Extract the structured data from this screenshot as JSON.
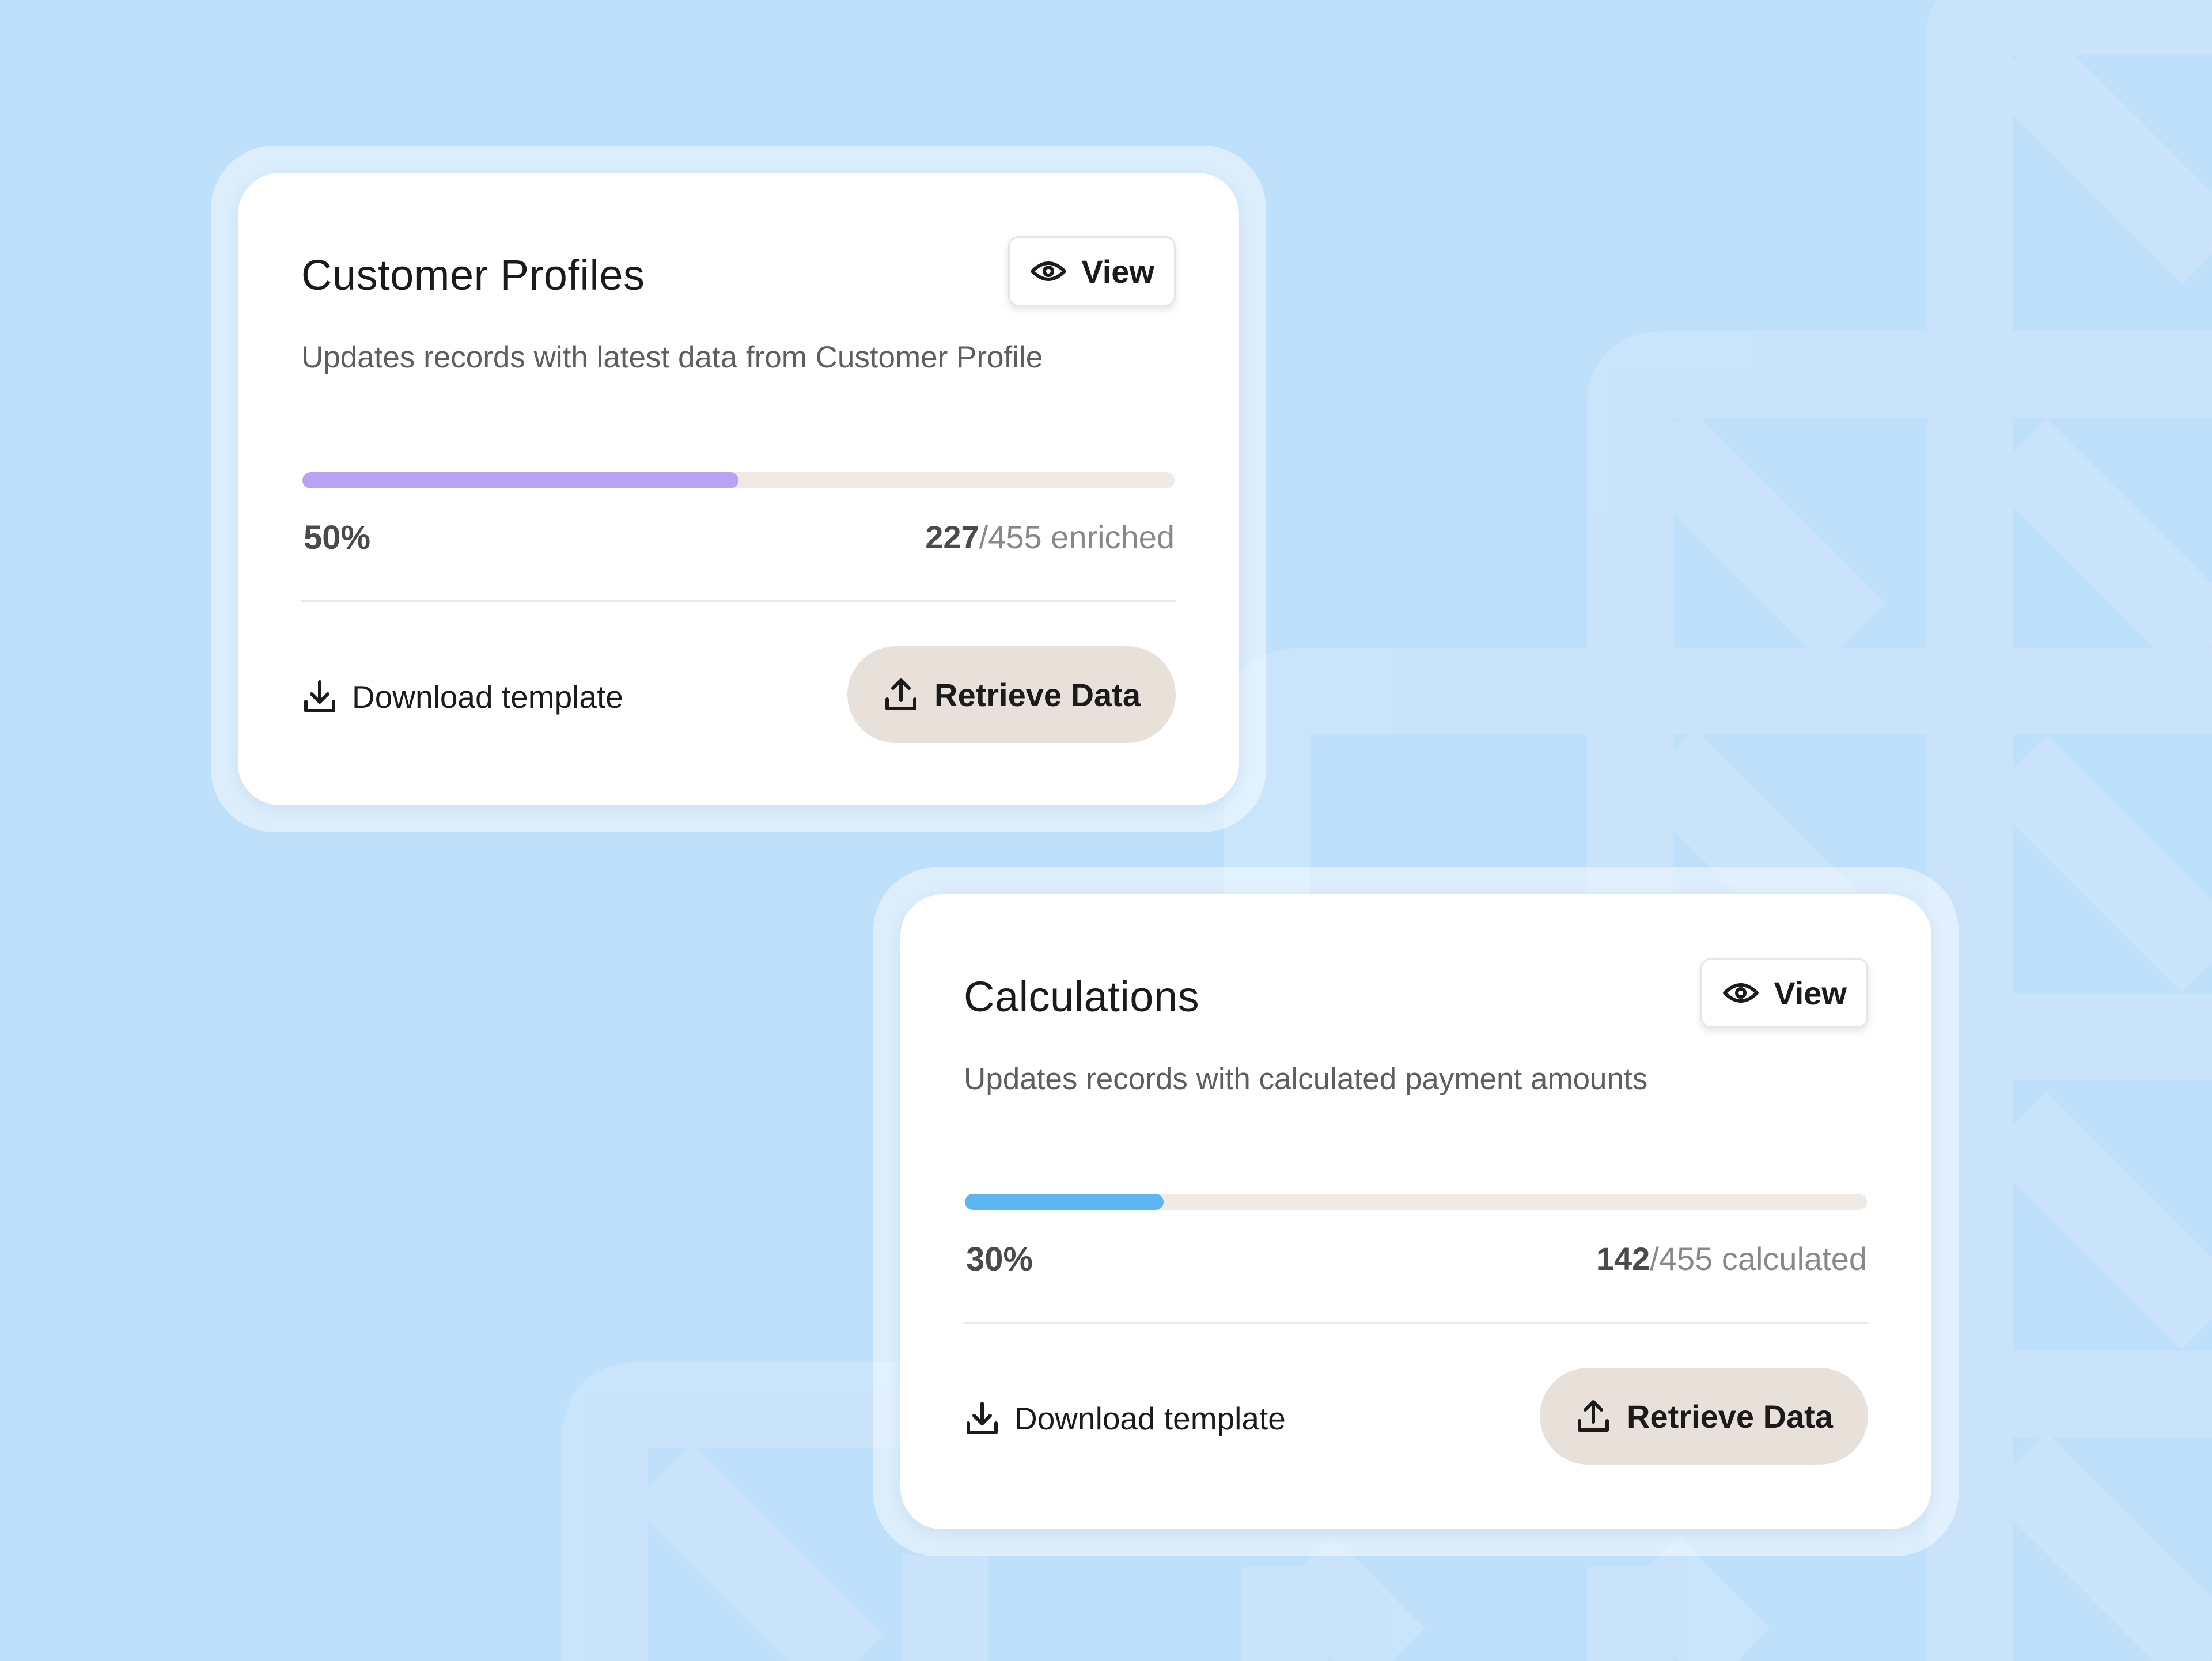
{
  "colors": {
    "background": "#bfe0fa",
    "card": "#ffffff",
    "track": "#efeae5",
    "retrieve_button": "#e8e1da"
  },
  "cards": [
    {
      "title": "Customer Profiles",
      "view_label": "View",
      "description": "Updates records with latest data from Customer Profile",
      "progress_percent": 50,
      "progress_label": "50%",
      "progress_color": "#b9a2f2",
      "count_done": "227",
      "count_rest": "/455 enriched",
      "download_label": "Download template",
      "retrieve_label": "Retrieve Data",
      "icons": {
        "view": "eye-icon",
        "download": "download-icon",
        "retrieve": "upload-icon"
      }
    },
    {
      "title": "Calculations",
      "view_label": "View",
      "description": "Updates records with calculated payment amounts",
      "progress_percent": 22,
      "progress_label": "30%",
      "progress_color": "#5cb6f2",
      "count_done": "142",
      "count_rest": "/455 calculated",
      "download_label": "Download template",
      "retrieve_label": "Retrieve Data",
      "icons": {
        "view": "eye-icon",
        "download": "download-icon",
        "retrieve": "upload-icon"
      }
    }
  ]
}
